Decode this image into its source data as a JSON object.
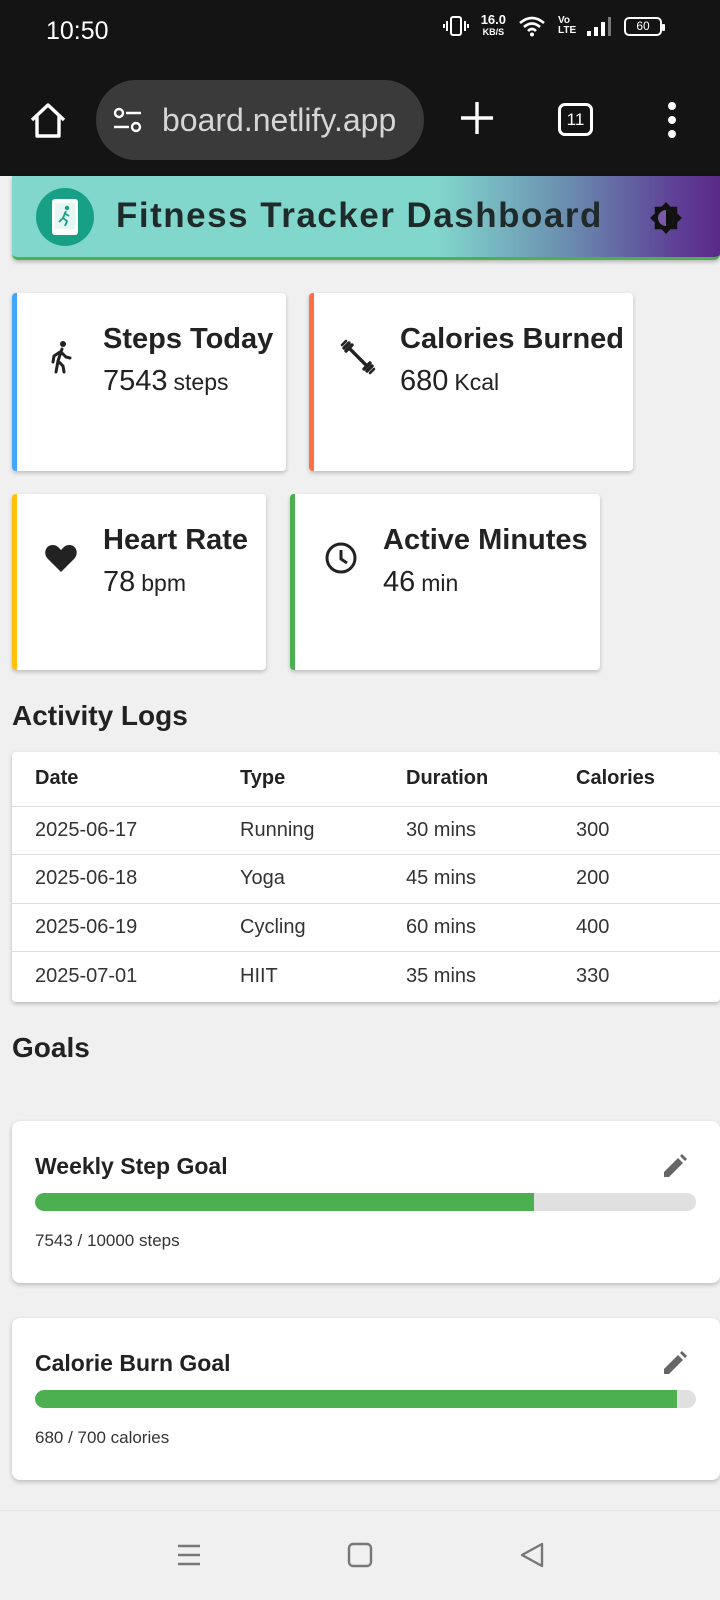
{
  "status_bar": {
    "time": "10:50",
    "net_speed": "16.0",
    "net_unit": "KB/S",
    "volte": "Vo LTE",
    "battery": "60"
  },
  "browser": {
    "url": "board.netlify.app",
    "tab_count": "11",
    "icons": [
      "home-icon",
      "site-settings-icon",
      "plus-icon",
      "tabs-icon",
      "more-vert-icon"
    ]
  },
  "header": {
    "title": "Fitness Tracker Dashboard",
    "logo_icon": "fitness-app-icon",
    "toggle_icon": "brightness-icon",
    "gradient": [
      "#82d7cd",
      "#5a2a88"
    ],
    "underline_color": "#4caf50"
  },
  "stats": [
    {
      "title": "Steps Today",
      "value": "7543",
      "unit": "steps",
      "icon": "walking-icon",
      "accent": "#42a5f5"
    },
    {
      "title": "Calories Burned",
      "value": "680",
      "unit": "Kcal",
      "icon": "dumbbell-icon",
      "accent": "#ff7043"
    },
    {
      "title": "Heart Rate",
      "value": "78",
      "unit": "bpm",
      "icon": "heart-icon",
      "accent": "#ffc107"
    },
    {
      "title": "Active Minutes",
      "value": "46",
      "unit": "min",
      "icon": "clock-icon",
      "accent": "#4caf50"
    }
  ],
  "activity_logs": {
    "title": "Activity Logs",
    "columns": [
      "Date",
      "Type",
      "Duration",
      "Calories"
    ],
    "rows": [
      [
        "2025-06-17",
        "Running",
        "30 mins",
        "300"
      ],
      [
        "2025-06-18",
        "Yoga",
        "45 mins",
        "200"
      ],
      [
        "2025-06-19",
        "Cycling",
        "60 mins",
        "400"
      ],
      [
        "2025-07-01",
        "HIIT",
        "35 mins",
        "330"
      ]
    ]
  },
  "goals": {
    "title": "Goals",
    "items": [
      {
        "title": "Weekly Step Goal",
        "progress_text": "7543 / 10000 steps",
        "progress": 0.7543,
        "icon": "edit-icon"
      },
      {
        "title": "Calorie Burn Goal",
        "progress_text": "680 / 700 calories",
        "progress": 0.9714,
        "icon": "edit-icon"
      }
    ],
    "bar_color": "#4caf50"
  },
  "nav": {
    "icons": [
      "recents-icon",
      "home-icon",
      "back-icon"
    ]
  }
}
